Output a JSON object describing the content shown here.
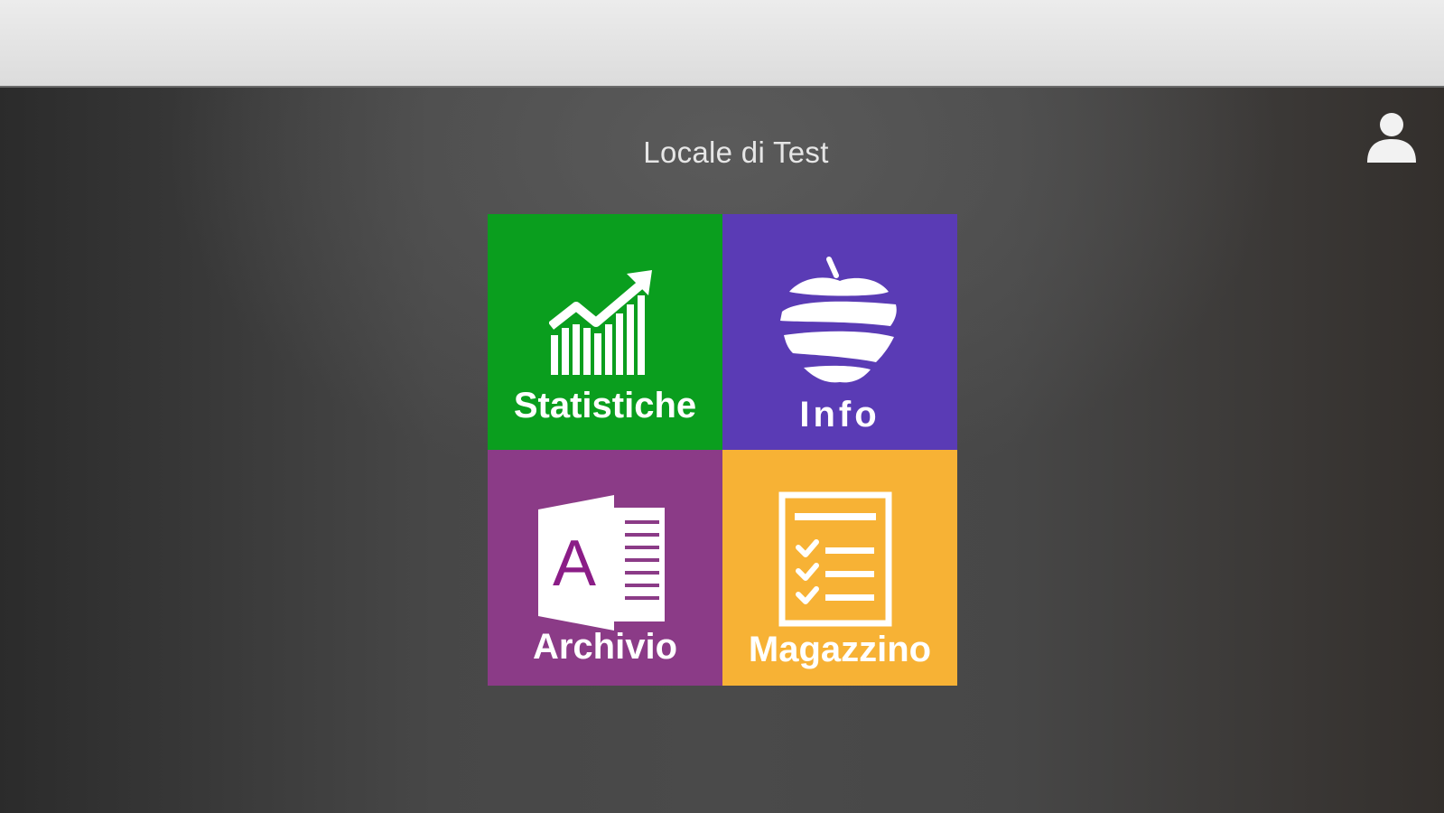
{
  "header": {
    "title": "Locale di Test",
    "user_icon": "user-icon"
  },
  "tiles": [
    {
      "label": "Statistiche",
      "color": "#0a9e1e",
      "icon": "chart-icon"
    },
    {
      "label": "Info",
      "color": "#5a3bb5",
      "icon": "apple-icon"
    },
    {
      "label": "Archivio",
      "color": "#8b3b87",
      "icon": "document-icon"
    },
    {
      "label": "Magazzino",
      "color": "#f7b235",
      "icon": "checklist-icon"
    }
  ],
  "colors": {
    "top_bar": "#dcdcdc",
    "background": "#474747",
    "title_text": "#e6e6e6"
  },
  "document_letter": "A"
}
